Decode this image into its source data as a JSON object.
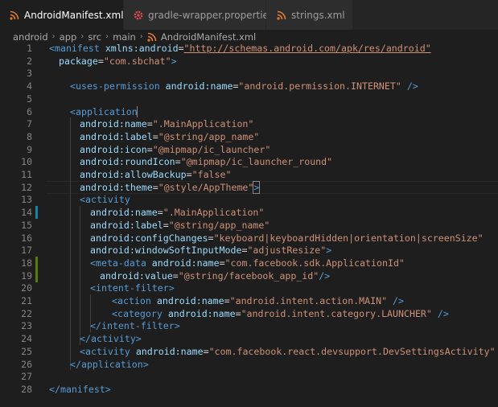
{
  "tabs": [
    {
      "label": "AndroidManifest.xml",
      "active": true,
      "icon": "rss-icon",
      "icon_color": "#e37933"
    },
    {
      "label": "gradle-wrapper.properties",
      "active": false,
      "icon": "gear-icon",
      "icon_color": "#e44d50"
    },
    {
      "label": "strings.xml",
      "active": false,
      "icon": "rss-icon",
      "icon_color": "#e37933"
    }
  ],
  "breadcrumb": [
    "android",
    "app",
    "src",
    "main",
    "AndroidManifest.xml"
  ],
  "lines": [
    {
      "n": "1",
      "indent": 0,
      "tokens": [
        [
          "tag",
          "<manifest"
        ],
        [
          "plain",
          " "
        ],
        [
          "attr",
          "xmlns:android"
        ],
        [
          "plain",
          "="
        ],
        [
          "val",
          "\"http://schemas.android.com/apk/res/android\""
        ]
      ]
    },
    {
      "n": "2",
      "indent": 1,
      "tokens": [
        [
          "attr",
          "package"
        ],
        [
          "plain",
          "="
        ],
        [
          "val",
          "\"com.sbchat\""
        ],
        [
          "tag",
          ">"
        ]
      ]
    },
    {
      "n": "3",
      "indent": 0,
      "tokens": []
    },
    {
      "n": "4",
      "indent": 2,
      "tokens": [
        [
          "tag",
          "<uses-permission"
        ],
        [
          "plain",
          " "
        ],
        [
          "attr",
          "android:name"
        ],
        [
          "plain",
          "="
        ],
        [
          "val",
          "\"android.permission.INTERNET\""
        ],
        [
          "plain",
          " "
        ],
        [
          "tag",
          "/>"
        ]
      ]
    },
    {
      "n": "5",
      "indent": 0,
      "tokens": []
    },
    {
      "n": "6",
      "indent": 2,
      "tokens": [
        [
          "tag",
          "<application"
        ]
      ]
    },
    {
      "n": "7",
      "indent": 3,
      "tokens": [
        [
          "attr",
          "android:name"
        ],
        [
          "plain",
          "="
        ],
        [
          "val",
          "\".MainApplication\""
        ]
      ]
    },
    {
      "n": "8",
      "indent": 3,
      "tokens": [
        [
          "attr",
          "android:label"
        ],
        [
          "plain",
          "="
        ],
        [
          "val",
          "\"@string/app_name\""
        ]
      ]
    },
    {
      "n": "9",
      "indent": 3,
      "tokens": [
        [
          "attr",
          "android:icon"
        ],
        [
          "plain",
          "="
        ],
        [
          "val",
          "\"@mipmap/ic_launcher\""
        ]
      ]
    },
    {
      "n": "10",
      "indent": 3,
      "tokens": [
        [
          "attr",
          "android:roundIcon"
        ],
        [
          "plain",
          "="
        ],
        [
          "val",
          "\"@mipmap/ic_launcher_round\""
        ]
      ]
    },
    {
      "n": "11",
      "indent": 3,
      "tokens": [
        [
          "attr",
          "android:allowBackup"
        ],
        [
          "plain",
          "="
        ],
        [
          "val",
          "\"false\""
        ]
      ]
    },
    {
      "n": "12",
      "indent": 3,
      "tokens": [
        [
          "attr",
          "android:theme"
        ],
        [
          "plain",
          "="
        ],
        [
          "val",
          "\"@style/AppTheme\""
        ],
        [
          "tag",
          ">"
        ]
      ]
    },
    {
      "n": "13",
      "indent": 3,
      "tokens": [
        [
          "tag",
          "<activity"
        ]
      ]
    },
    {
      "n": "14",
      "indent": 4,
      "tokens": [
        [
          "attr",
          "android:name"
        ],
        [
          "plain",
          "="
        ],
        [
          "val",
          "\".MainApplication\""
        ]
      ]
    },
    {
      "n": "15",
      "indent": 4,
      "tokens": [
        [
          "attr",
          "android:label"
        ],
        [
          "plain",
          "="
        ],
        [
          "val",
          "\"@string/app_name\""
        ]
      ]
    },
    {
      "n": "16",
      "indent": 4,
      "tokens": [
        [
          "attr",
          "android:configChanges"
        ],
        [
          "plain",
          "="
        ],
        [
          "val",
          "\"keyboard|keyboardHidden|orientation|screenSize\""
        ]
      ]
    },
    {
      "n": "17",
      "indent": 4,
      "tokens": [
        [
          "attr",
          "android:windowSoftInputMode"
        ],
        [
          "plain",
          "="
        ],
        [
          "val",
          "\"adjustResize\""
        ],
        [
          "tag",
          ">"
        ]
      ]
    },
    {
      "n": "18",
      "indent": 4,
      "tokens": [
        [
          "tag",
          "<meta-data"
        ],
        [
          "plain",
          " "
        ],
        [
          "attr",
          "android:name"
        ],
        [
          "plain",
          "="
        ],
        [
          "val",
          "\"com.facebook.sdk.ApplicationId\""
        ]
      ]
    },
    {
      "n": "19",
      "indent": 5,
      "tokens": [
        [
          "attr",
          "android:value"
        ],
        [
          "plain",
          "="
        ],
        [
          "val",
          "\"@string/facebook_app_id\""
        ],
        [
          "tag",
          "/>"
        ]
      ]
    },
    {
      "n": "20",
      "indent": 4,
      "tokens": [
        [
          "tag",
          "<intent-filter>"
        ]
      ]
    },
    {
      "n": "21",
      "indent": 6,
      "tokens": [
        [
          "tag",
          "<action"
        ],
        [
          "plain",
          " "
        ],
        [
          "attr",
          "android:name"
        ],
        [
          "plain",
          "="
        ],
        [
          "val",
          "\"android.intent.action.MAIN\""
        ],
        [
          "plain",
          " "
        ],
        [
          "tag",
          "/>"
        ]
      ]
    },
    {
      "n": "22",
      "indent": 6,
      "tokens": [
        [
          "tag",
          "<category"
        ],
        [
          "plain",
          " "
        ],
        [
          "attr",
          "android:name"
        ],
        [
          "plain",
          "="
        ],
        [
          "val",
          "\"android.intent.category.LAUNCHER\""
        ],
        [
          "plain",
          " "
        ],
        [
          "tag",
          "/>"
        ]
      ]
    },
    {
      "n": "23",
      "indent": 4,
      "tokens": [
        [
          "tag",
          "</intent-filter>"
        ]
      ]
    },
    {
      "n": "24",
      "indent": 3,
      "tokens": [
        [
          "tag",
          "</activity>"
        ]
      ]
    },
    {
      "n": "25",
      "indent": 3,
      "tokens": [
        [
          "tag",
          "<activity"
        ],
        [
          "plain",
          " "
        ],
        [
          "attr",
          "android:name"
        ],
        [
          "plain",
          "="
        ],
        [
          "val",
          "\"com.facebook.react.devsupport.DevSettingsActivity\""
        ],
        [
          "plain",
          " "
        ],
        [
          "tag",
          "/>"
        ]
      ]
    },
    {
      "n": "26",
      "indent": 2,
      "tokens": [
        [
          "tag",
          "</application>"
        ]
      ]
    },
    {
      "n": "27",
      "indent": 0,
      "tokens": []
    },
    {
      "n": "28",
      "indent": 0,
      "tokens": [
        [
          "tag",
          "</manifest>"
        ]
      ]
    }
  ],
  "gutter_marks": [
    {
      "line": "14",
      "color": "#1b81a8"
    },
    {
      "line": "18",
      "color": "#587c0c"
    },
    {
      "line": "19",
      "color": "#587c0c"
    }
  ],
  "colors": {
    "tag": "#569cd6",
    "attribute": "#9cdcfe",
    "string": "#ce9178",
    "line_number": "#858585",
    "background": "#1e1e1e"
  }
}
